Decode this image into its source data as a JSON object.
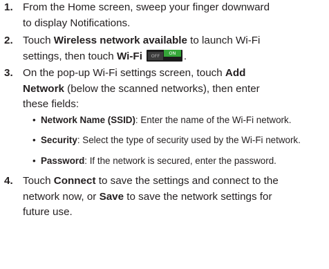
{
  "steps": [
    {
      "number": "1.",
      "lines": [
        "From the Home screen, sweep your finger downward",
        "to display Notifications."
      ]
    },
    {
      "number": "2.",
      "l1_a": "Touch ",
      "l1_b": "Wireless network available",
      "l1_c": " to launch Wi-Fi",
      "l2_a": "settings, then touch ",
      "l2_b": "Wi-Fi",
      "l2_c": ".",
      "toggle": {
        "off": "OFF",
        "on": "ON"
      }
    },
    {
      "number": "3.",
      "l1_a": "On the pop-up Wi-Fi settings screen, touch ",
      "l1_b": "Add",
      "l2_a": "Network",
      "l2_b": " (below the scanned networks), then enter",
      "l3": "these fields:"
    },
    {
      "number": "4.",
      "l1_a": "Touch ",
      "l1_b": "Connect",
      "l1_c": " to save the settings and connect to the",
      "l2_a": "network now, or ",
      "l2_b": "Save",
      "l2_c": " to save the network settings for",
      "l3": "future use."
    }
  ],
  "bullets": [
    {
      "symbol": "•",
      "term": "Network Name (SSID)",
      "text": ": Enter the name of the Wi-Fi network."
    },
    {
      "symbol": "•",
      "term": "Security",
      "text": ": Select the type of security used by the Wi-Fi network."
    },
    {
      "symbol": "•",
      "term": "Password",
      "text": ": If the network is secured, enter the password."
    }
  ],
  "colors": {
    "text": "#231f20",
    "toggle_on": "#35a639",
    "toggle_track": "#1b1b1b"
  }
}
